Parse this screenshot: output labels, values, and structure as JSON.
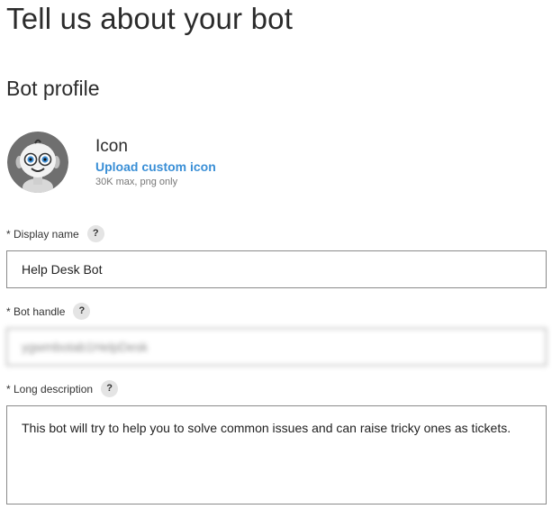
{
  "page": {
    "title": "Tell us about your bot"
  },
  "profile": {
    "section_title": "Bot profile",
    "icon": {
      "avatar_icon": "robot-face-avatar-icon",
      "label": "Icon",
      "upload_link": "Upload custom icon",
      "hint": "30K max, png only"
    }
  },
  "fields": {
    "display_name": {
      "label": "* Display name",
      "help": "?",
      "value": "Help Desk Bot"
    },
    "bot_handle": {
      "label": "* Bot handle",
      "help": "?",
      "value": "ygwmbotab1HelpDesk"
    },
    "long_description": {
      "label": "* Long description",
      "help": "?",
      "value": "This bot will try to help you to solve common issues and can raise tricky ones as tickets."
    }
  },
  "colors": {
    "link": "#3a8fd6",
    "help_badge_bg": "#e4e4e4",
    "input_border": "#8a8a8a"
  }
}
